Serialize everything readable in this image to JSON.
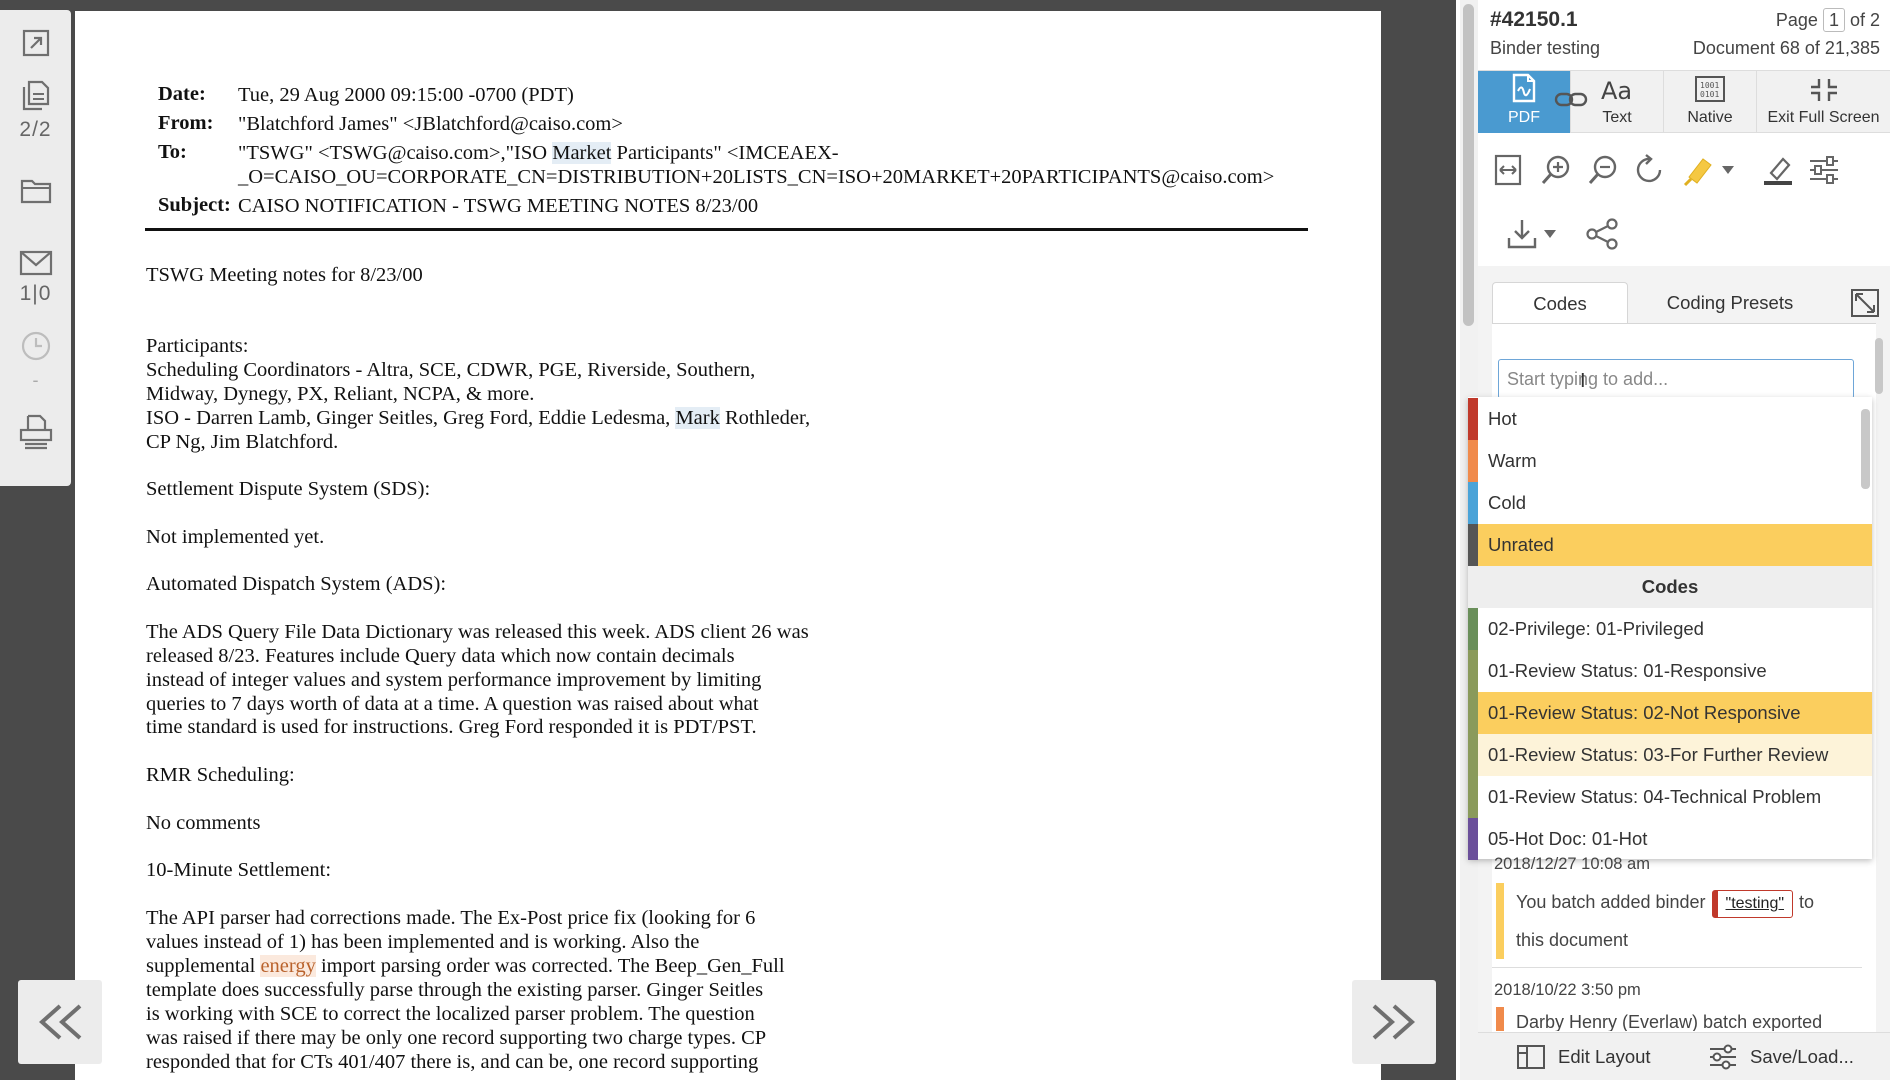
{
  "left_toolbar": {
    "pages_count": "2/2",
    "email_count": "1|0",
    "history_count": "-"
  },
  "document": {
    "header": {
      "date_label": "Date:",
      "date_value": "Tue, 29 Aug 2000 09:15:00 -0700 (PDT)",
      "from_label": "From:",
      "from_value": "\"Blatchford James\" <JBlatchford@caiso.com>",
      "to_label": "To:",
      "to_line1_a": "\"TSWG\" <TSWG@caiso.com>,\"ISO ",
      "to_line1_hl": "Market",
      "to_line1_b": " Participants\" <IMCEAEX-",
      "to_line2": "_O=CAISO_OU=CORPORATE_CN=DISTRIBUTION+20LISTS_CN=ISO+20MARKET+20PARTICIPANTS@caiso.com>",
      "subject_label": "Subject:",
      "subject_value": "CAISO NOTIFICATION - TSWG MEETING NOTES 8/23/00"
    },
    "body": {
      "l1": "TSWG Meeting notes for 8/23/00",
      "l2": "Participants:",
      "l3": "Scheduling Coordinators - Altra, SCE, CDWR, PGE, Riverside, Southern,",
      "l4": "Midway, Dynegy, PX, Reliant, NCPA, & more.",
      "l5a": "ISO - Darren Lamb, Ginger Seitles, Greg Ford, Eddie Ledesma, ",
      "l5hl": "Mark",
      "l5b": " Rothleder,",
      "l6": "CP Ng, Jim Blatchford.",
      "l7": "Settlement Dispute System (SDS):",
      "l8": "Not implemented yet.",
      "l9": "Automated Dispatch System (ADS):",
      "l10": "The ADS Query File Data Dictionary was released this week. ADS client 26 was",
      "l11": "released 8/23. Features include Query data which now contain decimals",
      "l12": "instead of integer values and system performance improvement by limiting",
      "l13": "queries to 7 days worth of data at a time. A question was raised about what",
      "l14": "time standard is used for instructions. Greg Ford responded it is PDT/PST.",
      "l15": "RMR Scheduling:",
      "l16": "No comments",
      "l17": "10-Minute Settlement:",
      "l18": "The API parser had corrections made. The Ex-Post price fix (looking for 6",
      "l19": "values instead of 1) has been implemented and is working. Also the",
      "l20a": "supplemental ",
      "l20hl": "energy",
      "l20b": " import parsing order was corrected. The Beep_Gen_Full",
      "l21": "template does successfully parse through the existing parser. Ginger Seitles",
      "l22": "is working with SCE to correct the localized parser problem. The question",
      "l23": "was raised if there may be only one record supporting two charge types. CP",
      "l24": "responded that for CTs 401/407 there is, and can be, one record supporting"
    }
  },
  "panel": {
    "doc_id": "#42150.1",
    "binder": "Binder testing",
    "page_label": "Page",
    "page_current": "1",
    "page_of": "of 2",
    "document_position": "Document 68 of 21,385",
    "view_tabs": [
      "PDF",
      "Text",
      "Native",
      "Exit Full Screen"
    ],
    "code_tabs": [
      "Codes",
      "Coding Presets"
    ],
    "search_placeholder": "Start typing to add...",
    "ratings": [
      {
        "label": "Hot",
        "color": "#c0392b"
      },
      {
        "label": "Warm",
        "color": "#f08a4b"
      },
      {
        "label": "Cold",
        "color": "#4aa3d8"
      },
      {
        "label": "Unrated",
        "color": "#555555"
      }
    ],
    "codes_header": "Codes",
    "codes": [
      {
        "label": "02-Privilege: 01-Privileged",
        "color": "#6a8f5a"
      },
      {
        "label": "01-Review Status: 01-Responsive",
        "color": "#8a9a5b"
      },
      {
        "label": "01-Review Status: 02-Not Responsive",
        "color": "#8a9a5b"
      },
      {
        "label": "01-Review Status: 03-For Further Review",
        "color": "#8a9a5b"
      },
      {
        "label": "01-Review Status: 04-Technical Problem",
        "color": "#8a9a5b"
      },
      {
        "label": "05-Hot Doc: 01-Hot",
        "color": "#6b4f9a"
      }
    ],
    "activity": [
      {
        "date": "2018/12/27 10:08 am",
        "text_a": "You batch added binder",
        "tag": "\"testing\"",
        "text_b": "to",
        "text_c": "this document"
      },
      {
        "date": "2018/10/22 3:50 pm",
        "text_a": "Darby Henry (Everlaw) batch exported"
      }
    ],
    "bottom": {
      "edit_layout": "Edit Layout",
      "save_load": "Save/Load..."
    },
    "accent": "#4a9ad0",
    "selected_color": "#fbce5e"
  }
}
